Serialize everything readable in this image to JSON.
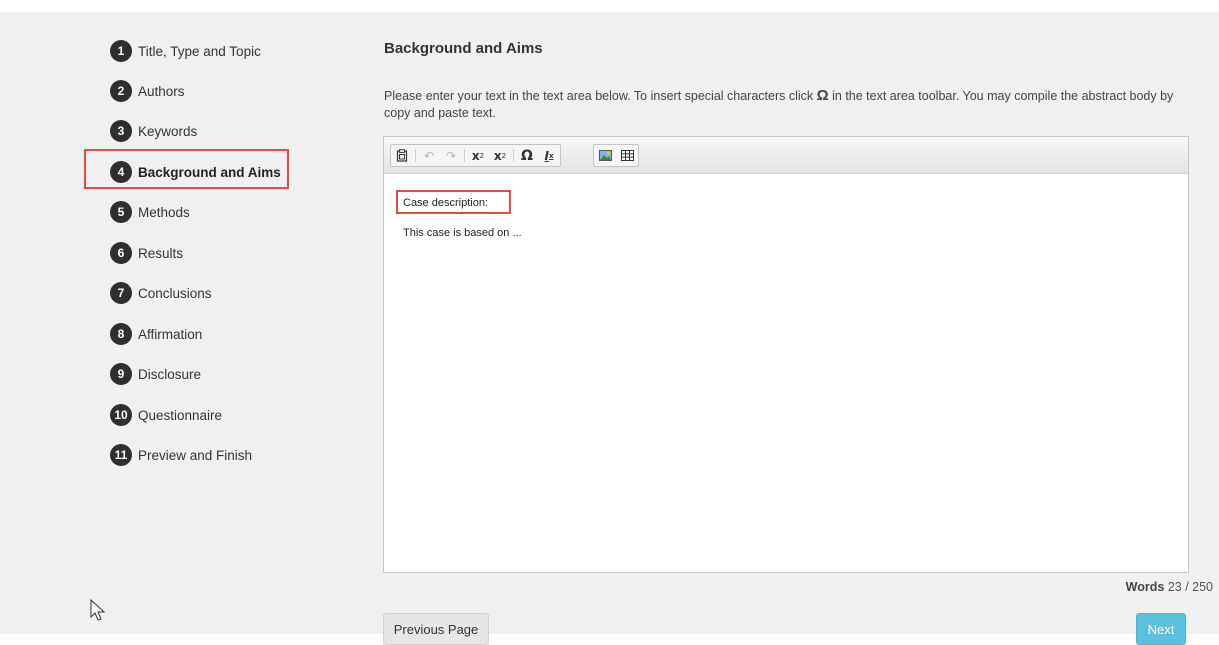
{
  "steps": [
    {
      "num": "1",
      "label": "Title, Type and Topic"
    },
    {
      "num": "2",
      "label": "Authors"
    },
    {
      "num": "3",
      "label": "Keywords"
    },
    {
      "num": "4",
      "label": "Background and Aims"
    },
    {
      "num": "5",
      "label": "Methods"
    },
    {
      "num": "6",
      "label": "Results"
    },
    {
      "num": "7",
      "label": "Conclusions"
    },
    {
      "num": "8",
      "label": "Affirmation"
    },
    {
      "num": "9",
      "label": "Disclosure"
    },
    {
      "num": "10",
      "label": "Questionnaire"
    },
    {
      "num": "11",
      "label": "Preview and Finish"
    }
  ],
  "section": {
    "title": "Background and Aims",
    "instructions_before": "Please enter your text in the text area below. To insert special characters click ",
    "instructions_symbol": "Ω",
    "instructions_after": " in the text area toolbar. You may compile the abstract body by copy and paste text."
  },
  "editor": {
    "toolbar": {
      "paste_icon": "clipboard-icon",
      "undo_icon": "undo-icon",
      "redo_icon": "redo-icon",
      "subscript_icon": "subscript-icon",
      "superscript_icon": "superscript-icon",
      "special_char_icon": "omega-icon",
      "remove_format_icon": "remove-format-icon",
      "image_icon": "image-icon",
      "table_icon": "table-icon"
    },
    "lines": [
      "Case description:",
      "This case is based on ..."
    ]
  },
  "word_count": {
    "label": "Words",
    "value": "23 / 250"
  },
  "buttons": {
    "previous": "Previous Page",
    "next": "Next"
  },
  "colors": {
    "highlight": "#e24b4b",
    "next_button": "#5bc0de",
    "step_badge": "#2f2f2f"
  }
}
